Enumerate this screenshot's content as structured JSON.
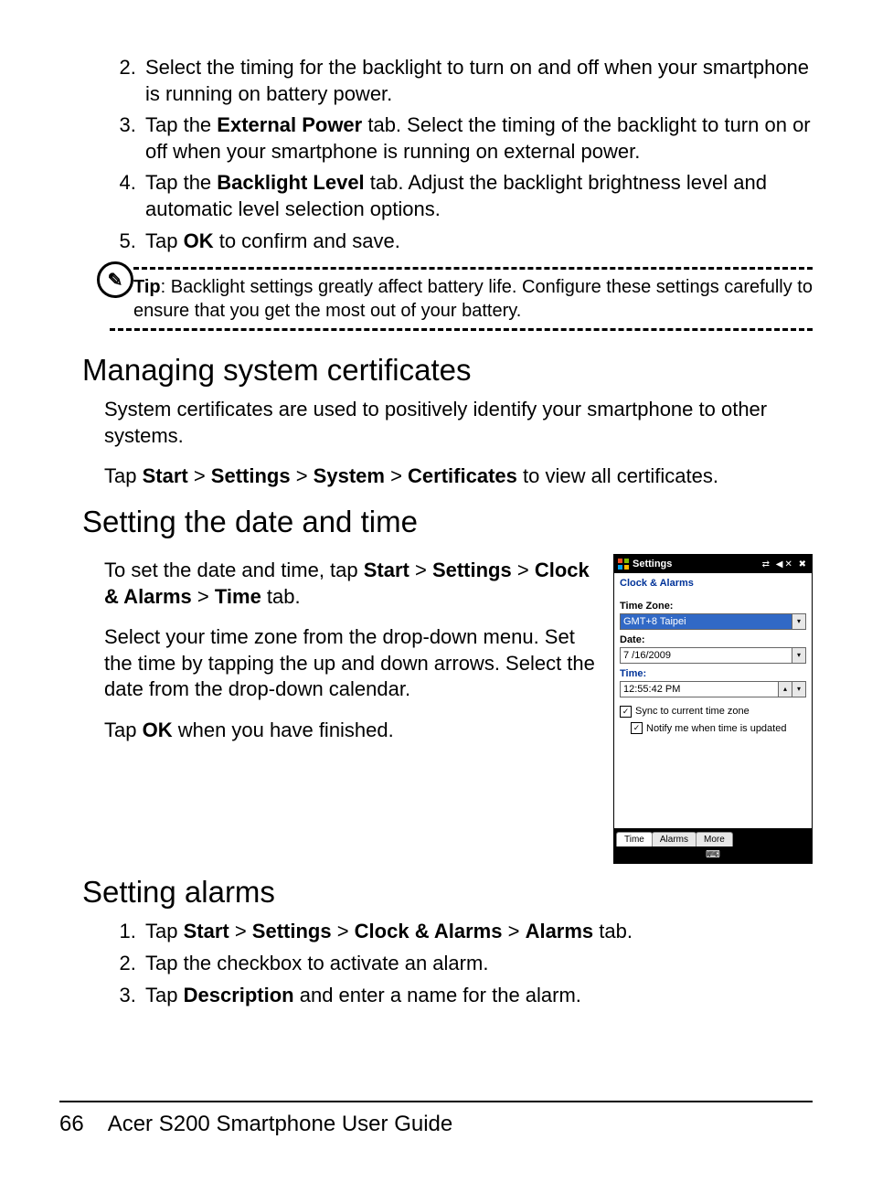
{
  "steps": {
    "s2": "Select the timing for the backlight to turn on and off when your smartphone is running on battery power.",
    "s3_a": "Tap the ",
    "s3_b": "External Power",
    "s3_c": " tab. Select the timing of the back­light to turn on or off when your smartphone is running on external power.",
    "s4_a": "Tap the ",
    "s4_b": "Backlight Level",
    "s4_c": " tab. Adjust the backlight brightness level and automatic level selection options.",
    "s5_a": "Tap ",
    "s5_b": "OK",
    "s5_c": " to confirm and save."
  },
  "tip": {
    "label": "Tip",
    "text": ": Backlight settings greatly affect battery life. Configure these set­tings carefully to ensure that you get the most out of your battery."
  },
  "certificates": {
    "heading": "Managing system certificates",
    "p1": "System certificates are used to positively identify your smart­phone to other systems.",
    "p2_a": "Tap ",
    "p2_b": "Start",
    "p2_c": " > ",
    "p2_d": "Settings",
    "p2_e": " > ",
    "p2_f": "System",
    "p2_g": " > ",
    "p2_h": "Certificates",
    "p2_i": " to view all certificates."
  },
  "datetime": {
    "heading": "Setting the date and time",
    "p1_a": "To set the date and time, tap ",
    "p1_b": "Start",
    "p1_c": " > ",
    "p1_d": "Set­tings",
    "p1_e": " > ",
    "p1_f": "Clock & Alarms",
    "p1_g": " > ",
    "p1_h": "Time",
    "p1_i": " tab.",
    "p2": "Select your time zone from the drop-down menu. Set the time by tapping the up and down arrows. Select the date from the drop-down calendar.",
    "p3_a": "Tap ",
    "p3_b": "OK",
    "p3_c": " when you have finished."
  },
  "alarms": {
    "heading": "Setting alarms",
    "s1_a": "Tap ",
    "s1_b": "Start",
    "s1_c": " > ",
    "s1_d": "Settings",
    "s1_e": " > ",
    "s1_f": "Clock & Alarms",
    "s1_g": " > ",
    "s1_h": "Alarms",
    "s1_i": " tab.",
    "s2": "Tap the checkbox to activate an alarm.",
    "s3_a": "Tap ",
    "s3_b": "Description",
    "s3_c": " and enter a name for the alarm."
  },
  "screenshot": {
    "header": "Settings",
    "title2": "Clock & Alarms",
    "tz_label": "Time Zone:",
    "tz_value": "GMT+8 Taipei",
    "date_label": "Date:",
    "date_value": "7 /16/2009",
    "time_label": "Time:",
    "time_value": "12:55:42 PM",
    "chk1": "Sync to current time zone",
    "chk2": "Notify me when time is updated",
    "tab_time": "Time",
    "tab_alarms": "Alarms",
    "tab_more": "More",
    "kb_icon": "⌨"
  },
  "footer": {
    "page": "66",
    "title": "Acer S200 Smartphone User Guide"
  }
}
